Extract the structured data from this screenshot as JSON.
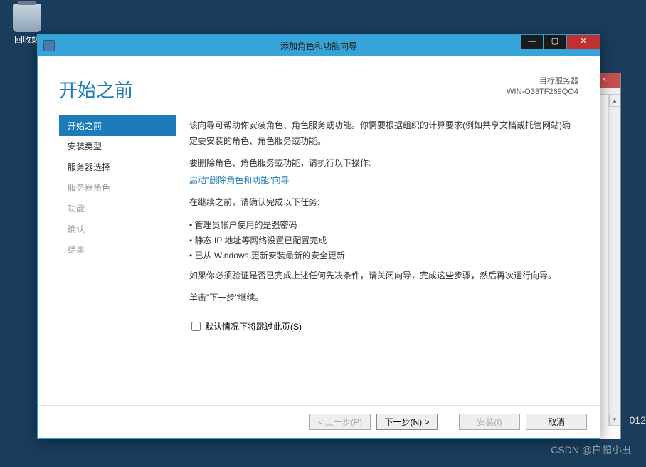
{
  "desktop": {
    "recycle_label": "回收站"
  },
  "bg_window": {
    "close": "×",
    "scroll_up": "▴",
    "scroll_down": "▾"
  },
  "wizard": {
    "title": "添加角色和功能向导",
    "controls": {
      "min": "—",
      "max": "▢",
      "close": "✕"
    },
    "page_title": "开始之前",
    "target_label": "目标服务器",
    "target_server": "WIN-O33TF269QO4",
    "sidebar": [
      {
        "label": "开始之前",
        "state": "active"
      },
      {
        "label": "安装类型",
        "state": "enabled"
      },
      {
        "label": "服务器选择",
        "state": "enabled"
      },
      {
        "label": "服务器角色",
        "state": "disabled"
      },
      {
        "label": "功能",
        "state": "disabled"
      },
      {
        "label": "确认",
        "state": "disabled"
      },
      {
        "label": "结果",
        "state": "disabled"
      }
    ],
    "content": {
      "intro": "该向导可帮助你安装角色、角色服务或功能。你需要根据组织的计算要求(例如共享文档或托管网站)确定要安装的角色、角色服务或功能。",
      "remove_prompt": "要删除角色、角色服务或功能，请执行以下操作:",
      "remove_link": "启动\"删除角色和功能\"向导",
      "tasks_prompt": "在继续之前，请确认完成以下任务:",
      "tasks": [
        "管理员帐户使用的是强密码",
        "静态 IP 地址等网络设置已配置完成",
        "已从 Windows 更新安装最新的安全更新"
      ],
      "verify_note": "如果你必须验证是否已完成上述任何先决条件，请关闭向导，完成这些步骤，然后再次运行向导。",
      "continue_note": "单击\"下一步\"继续。",
      "skip_checkbox": "默认情况下将跳过此页(S)"
    },
    "buttons": {
      "prev": "< 上一步(P)",
      "next": "下一步(N) >",
      "install": "安装(I)",
      "cancel": "取消"
    }
  },
  "watermark": "CSDN @白帽小丑",
  "clock_fragment": "012"
}
